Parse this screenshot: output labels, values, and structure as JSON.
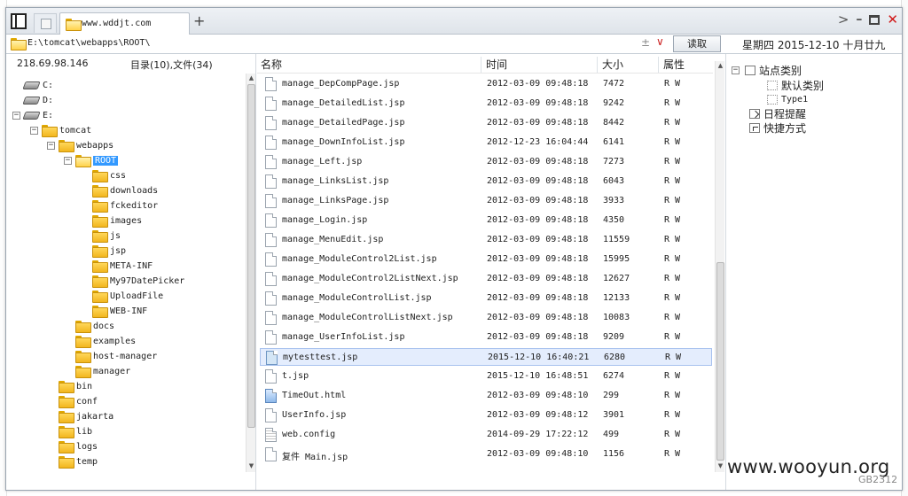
{
  "tab": {
    "title": "www.wddjt.com",
    "new_tab": "+"
  },
  "window_controls": {
    "nav": ">",
    "minimize": "–",
    "close": "✕"
  },
  "address": {
    "path": "E:\\tomcat\\webapps\\ROOT\\",
    "sort_glyph": "±",
    "dropdown_glyph": "∨",
    "read_button": "读取"
  },
  "calendar": {
    "date": "星期四 2015-12-10 十月廿九"
  },
  "tree": {
    "ip": "218.69.98.146",
    "summary": "目录(10),文件(34)",
    "items": [
      {
        "label": "C:",
        "type": "drive",
        "level": 1,
        "expander": ""
      },
      {
        "label": "D:",
        "type": "drive",
        "level": 1,
        "expander": ""
      },
      {
        "label": "E:",
        "type": "drive",
        "level": 1,
        "expander": "−"
      },
      {
        "label": "tomcat",
        "type": "folder",
        "level": 2,
        "expander": "−"
      },
      {
        "label": "webapps",
        "type": "folder",
        "level": 3,
        "expander": "−"
      },
      {
        "label": "ROOT",
        "type": "folder-open",
        "level": 4,
        "expander": "−",
        "selected": true
      },
      {
        "label": "css",
        "type": "folder",
        "level": 5,
        "expander": ""
      },
      {
        "label": "downloads",
        "type": "folder",
        "level": 5,
        "expander": ""
      },
      {
        "label": "fckeditor",
        "type": "folder",
        "level": 5,
        "expander": ""
      },
      {
        "label": "images",
        "type": "folder",
        "level": 5,
        "expander": ""
      },
      {
        "label": "js",
        "type": "folder",
        "level": 5,
        "expander": ""
      },
      {
        "label": "jsp",
        "type": "folder",
        "level": 5,
        "expander": ""
      },
      {
        "label": "META-INF",
        "type": "folder",
        "level": 5,
        "expander": ""
      },
      {
        "label": "My97DatePicker",
        "type": "folder",
        "level": 5,
        "expander": ""
      },
      {
        "label": "UploadFile",
        "type": "folder",
        "level": 5,
        "expander": ""
      },
      {
        "label": "WEB-INF",
        "type": "folder",
        "level": 5,
        "expander": ""
      },
      {
        "label": "docs",
        "type": "folder",
        "level": 4,
        "expander": ""
      },
      {
        "label": "examples",
        "type": "folder",
        "level": 4,
        "expander": ""
      },
      {
        "label": "host-manager",
        "type": "folder",
        "level": 4,
        "expander": ""
      },
      {
        "label": "manager",
        "type": "folder",
        "level": 4,
        "expander": ""
      },
      {
        "label": "bin",
        "type": "folder",
        "level": 3,
        "expander": ""
      },
      {
        "label": "conf",
        "type": "folder",
        "level": 3,
        "expander": ""
      },
      {
        "label": "jakarta",
        "type": "folder",
        "level": 3,
        "expander": ""
      },
      {
        "label": "lib",
        "type": "folder",
        "level": 3,
        "expander": ""
      },
      {
        "label": "logs",
        "type": "folder",
        "level": 3,
        "expander": ""
      },
      {
        "label": "temp",
        "type": "folder",
        "level": 3,
        "expander": ""
      }
    ]
  },
  "columns": {
    "name": "名称",
    "time": "时间",
    "size": "大小",
    "attr": "属性"
  },
  "files": [
    {
      "name": "manage_DepCompPage.jsp",
      "time": "2012-03-09 09:48:18",
      "size": "7472",
      "attr": "R W",
      "icon": "file"
    },
    {
      "name": "manage_DetailedList.jsp",
      "time": "2012-03-09 09:48:18",
      "size": "9242",
      "attr": "R W",
      "icon": "file"
    },
    {
      "name": "manage_DetailedPage.jsp",
      "time": "2012-03-09 09:48:18",
      "size": "8442",
      "attr": "R W",
      "icon": "file"
    },
    {
      "name": "manage_DownInfoList.jsp",
      "time": "2012-12-23 16:04:44",
      "size": "6141",
      "attr": "R W",
      "icon": "file"
    },
    {
      "name": "manage_Left.jsp",
      "time": "2012-03-09 09:48:18",
      "size": "7273",
      "attr": "R W",
      "icon": "file"
    },
    {
      "name": "manage_LinksList.jsp",
      "time": "2012-03-09 09:48:18",
      "size": "6043",
      "attr": "R W",
      "icon": "file"
    },
    {
      "name": "manage_LinksPage.jsp",
      "time": "2012-03-09 09:48:18",
      "size": "3933",
      "attr": "R W",
      "icon": "file"
    },
    {
      "name": "manage_Login.jsp",
      "time": "2012-03-09 09:48:18",
      "size": "4350",
      "attr": "R W",
      "icon": "file"
    },
    {
      "name": "manage_MenuEdit.jsp",
      "time": "2012-03-09 09:48:18",
      "size": "11559",
      "attr": "R W",
      "icon": "file"
    },
    {
      "name": "manage_ModuleControl2List.jsp",
      "time": "2012-03-09 09:48:18",
      "size": "15995",
      "attr": "R W",
      "icon": "file"
    },
    {
      "name": "manage_ModuleControl2ListNext.jsp",
      "time": "2012-03-09 09:48:18",
      "size": "12627",
      "attr": "R W",
      "icon": "file"
    },
    {
      "name": "manage_ModuleControlList.jsp",
      "time": "2012-03-09 09:48:18",
      "size": "12133",
      "attr": "R W",
      "icon": "file"
    },
    {
      "name": "manage_ModuleControlListNext.jsp",
      "time": "2012-03-09 09:48:18",
      "size": "10083",
      "attr": "R W",
      "icon": "file"
    },
    {
      "name": "manage_UserInfoList.jsp",
      "time": "2012-03-09 09:48:18",
      "size": "9209",
      "attr": "R W",
      "icon": "file"
    },
    {
      "name": "mytesttest.jsp",
      "time": "2015-12-10 16:40:21",
      "size": "6280",
      "attr": "R W",
      "icon": "file",
      "selected": true
    },
    {
      "name": "t.jsp",
      "time": "2015-12-10 16:48:51",
      "size": "6274",
      "attr": "R W",
      "icon": "file"
    },
    {
      "name": "TimeOut.html",
      "time": "2012-03-09 09:48:10",
      "size": "299",
      "attr": "R W",
      "icon": "html"
    },
    {
      "name": "UserInfo.jsp",
      "time": "2012-03-09 09:48:12",
      "size": "3901",
      "attr": "R W",
      "icon": "file"
    },
    {
      "name": "web.config",
      "time": "2014-09-29 17:22:12",
      "size": "499",
      "attr": "R W",
      "icon": "config"
    },
    {
      "name": "复件 Main.jsp",
      "time": "2012-03-09 09:48:10",
      "size": "1156",
      "attr": "R W",
      "icon": "file"
    }
  ],
  "categories": {
    "site_category": "站点类别",
    "default_category": "默认类别",
    "type1": "Type1",
    "schedule": "日程提醒",
    "shortcut": "快捷方式",
    "expander": "−"
  },
  "watermark": "www.wooyun.org",
  "encoding": "GB2312"
}
